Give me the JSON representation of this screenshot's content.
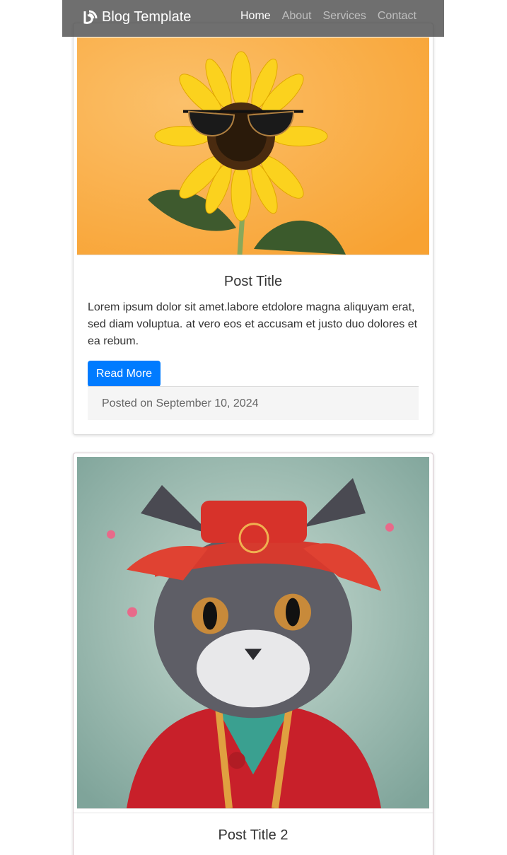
{
  "nav": {
    "brand": "Blog Template",
    "links": [
      "Home",
      "About",
      "Services",
      "Contact"
    ]
  },
  "posts": [
    {
      "title": "Post Title",
      "excerpt": "Lorem ipsum dolor sit amet.labore etdolore magna aliquyam erat, sed diam voluptua. at vero eos et accusam et justo duo dolores et ea rebum.",
      "button": "Read More",
      "posted": "Posted on September 10, 2024",
      "image": "sunflower-with-sunglasses"
    },
    {
      "title": "Post Title 2",
      "image": "cat-in-red-costume"
    }
  ],
  "colors": {
    "primary": "#007bff",
    "navbar": "#464646"
  }
}
